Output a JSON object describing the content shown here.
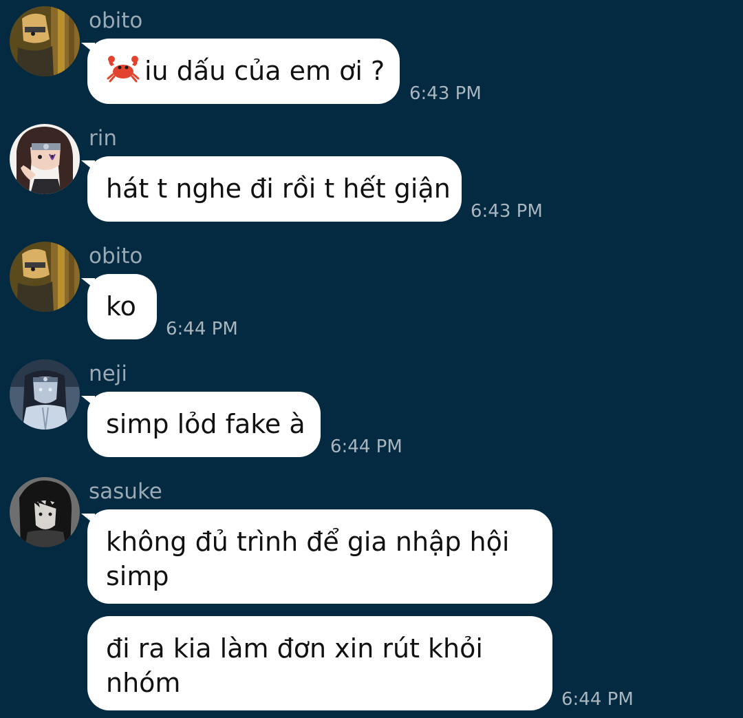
{
  "messages": [
    {
      "sender": "obito",
      "avatar_icon": "obito-avatar-icon",
      "text": "iu dấu của em ơi ?",
      "emoji_icon": "crab-emoji-icon",
      "time": "6:43 PM"
    },
    {
      "sender": "rin",
      "avatar_icon": "rin-avatar-icon",
      "text": "hát t nghe đi rồi t hết giận",
      "time": "6:43 PM"
    },
    {
      "sender": "obito",
      "avatar_icon": "obito-avatar-icon",
      "text": "ko",
      "time": "6:44 PM"
    },
    {
      "sender": "neji",
      "avatar_icon": "neji-avatar-icon",
      "text": "simp lỏd fake à",
      "time": "6:44 PM"
    },
    {
      "sender": "sasuke",
      "avatar_icon": "sasuke-avatar-icon",
      "text": "không đủ trình để gia nhập hội simp",
      "text2": "đi ra kia làm đơn xin rút khỏi nhóm",
      "time": "6:44 PM"
    }
  ],
  "colors": {
    "background": "#032a41",
    "bubble": "#ffffff",
    "sender_name": "#9aa9b4",
    "timestamp": "#a9b6bf"
  }
}
